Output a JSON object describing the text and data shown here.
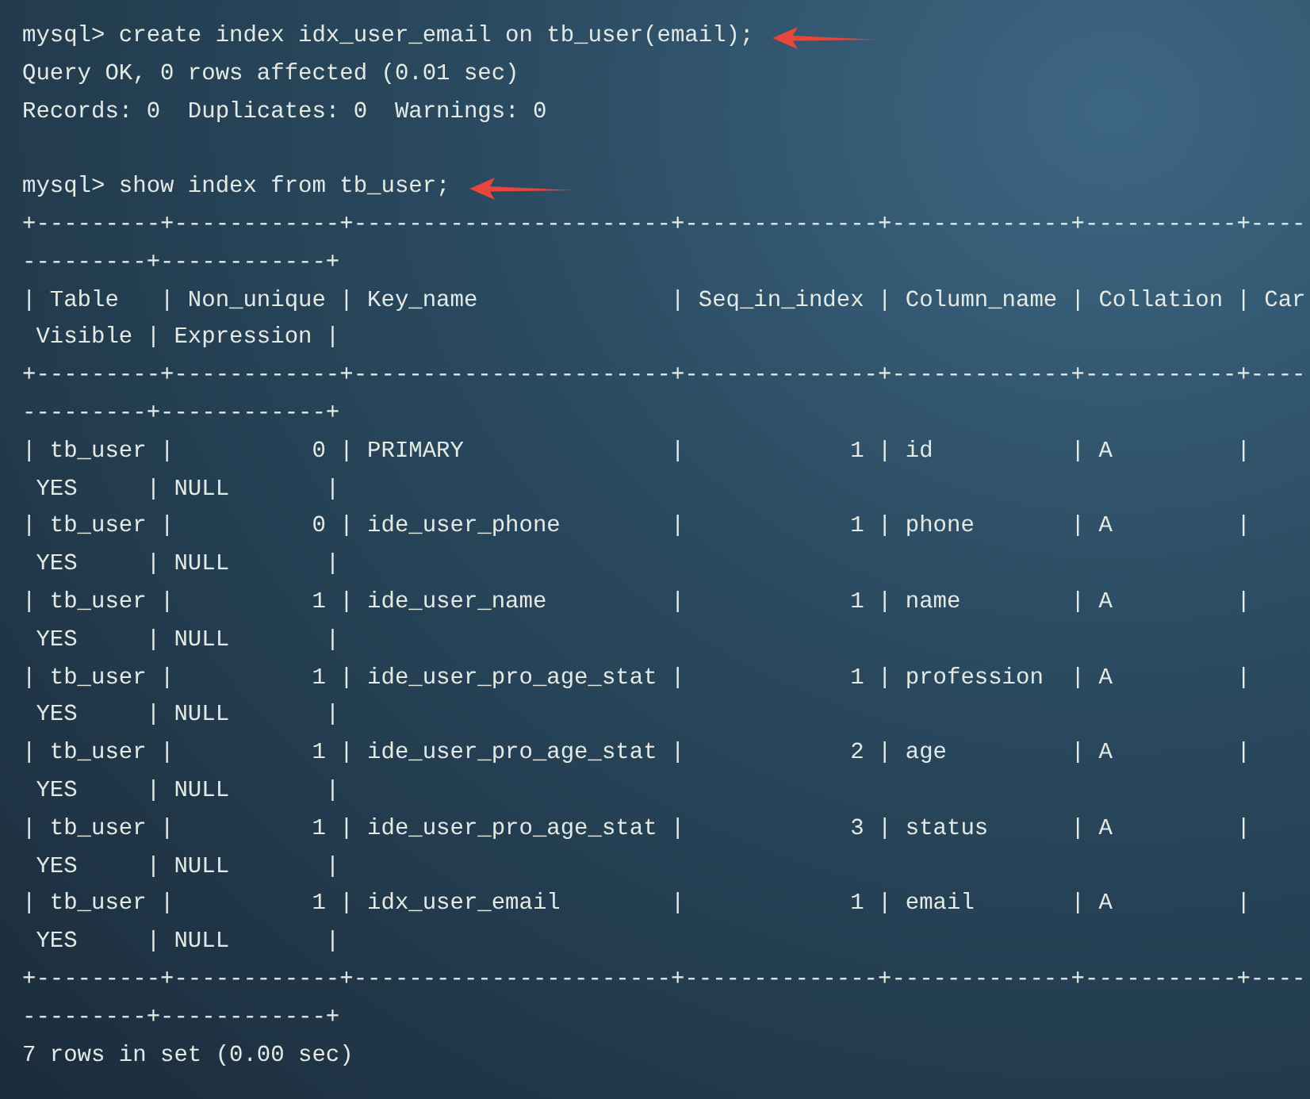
{
  "terminal": {
    "lines": [
      {
        "kind": "command",
        "text": "mysql> create index idx_user_email on tb_user(email);"
      },
      {
        "kind": "text",
        "text": "Query OK, 0 rows affected (0.01 sec)"
      },
      {
        "kind": "text",
        "text": "Records: 0  Duplicates: 0  Warnings: 0"
      },
      {
        "kind": "blank"
      },
      {
        "kind": "command",
        "text": "mysql> show index from tb_user;"
      },
      {
        "kind": "text",
        "text": "+---------+------------+-----------------------+--------------+-------------+-----------+----"
      },
      {
        "kind": "text",
        "text": "---------+------------+"
      },
      {
        "kind": "text",
        "text": "| Table   | Non_unique | Key_name              | Seq_in_index | Column_name | Collation | Car"
      },
      {
        "kind": "text",
        "text": " Visible | Expression |"
      },
      {
        "kind": "text",
        "text": "+---------+------------+-----------------------+--------------+-------------+-----------+----"
      },
      {
        "kind": "text",
        "text": "---------+------------+"
      },
      {
        "kind": "text",
        "text": "| tb_user |          0 | PRIMARY               |            1 | id          | A         |"
      },
      {
        "kind": "text",
        "text": " YES     | NULL       |"
      },
      {
        "kind": "text",
        "text": "| tb_user |          0 | ide_user_phone        |            1 | phone       | A         |"
      },
      {
        "kind": "text",
        "text": " YES     | NULL       |"
      },
      {
        "kind": "text",
        "text": "| tb_user |          1 | ide_user_name         |            1 | name        | A         |"
      },
      {
        "kind": "text",
        "text": " YES     | NULL       |"
      },
      {
        "kind": "text",
        "text": "| tb_user |          1 | ide_user_pro_age_stat |            1 | profession  | A         |"
      },
      {
        "kind": "text",
        "text": " YES     | NULL       |"
      },
      {
        "kind": "text",
        "text": "| tb_user |          1 | ide_user_pro_age_stat |            2 | age         | A         |"
      },
      {
        "kind": "text",
        "text": " YES     | NULL       |"
      },
      {
        "kind": "text",
        "text": "| tb_user |          1 | ide_user_pro_age_stat |            3 | status      | A         |"
      },
      {
        "kind": "text",
        "text": " YES     | NULL       |"
      },
      {
        "kind": "text",
        "text": "| tb_user |          1 | idx_user_email        |            1 | email       | A         |"
      },
      {
        "kind": "text",
        "text": " YES     | NULL       |"
      },
      {
        "kind": "text",
        "text": "+---------+------------+-----------------------+--------------+-------------+-----------+----"
      },
      {
        "kind": "text",
        "text": "---------+------------+"
      },
      {
        "kind": "text",
        "text": "7 rows in set (0.00 sec)"
      }
    ]
  }
}
